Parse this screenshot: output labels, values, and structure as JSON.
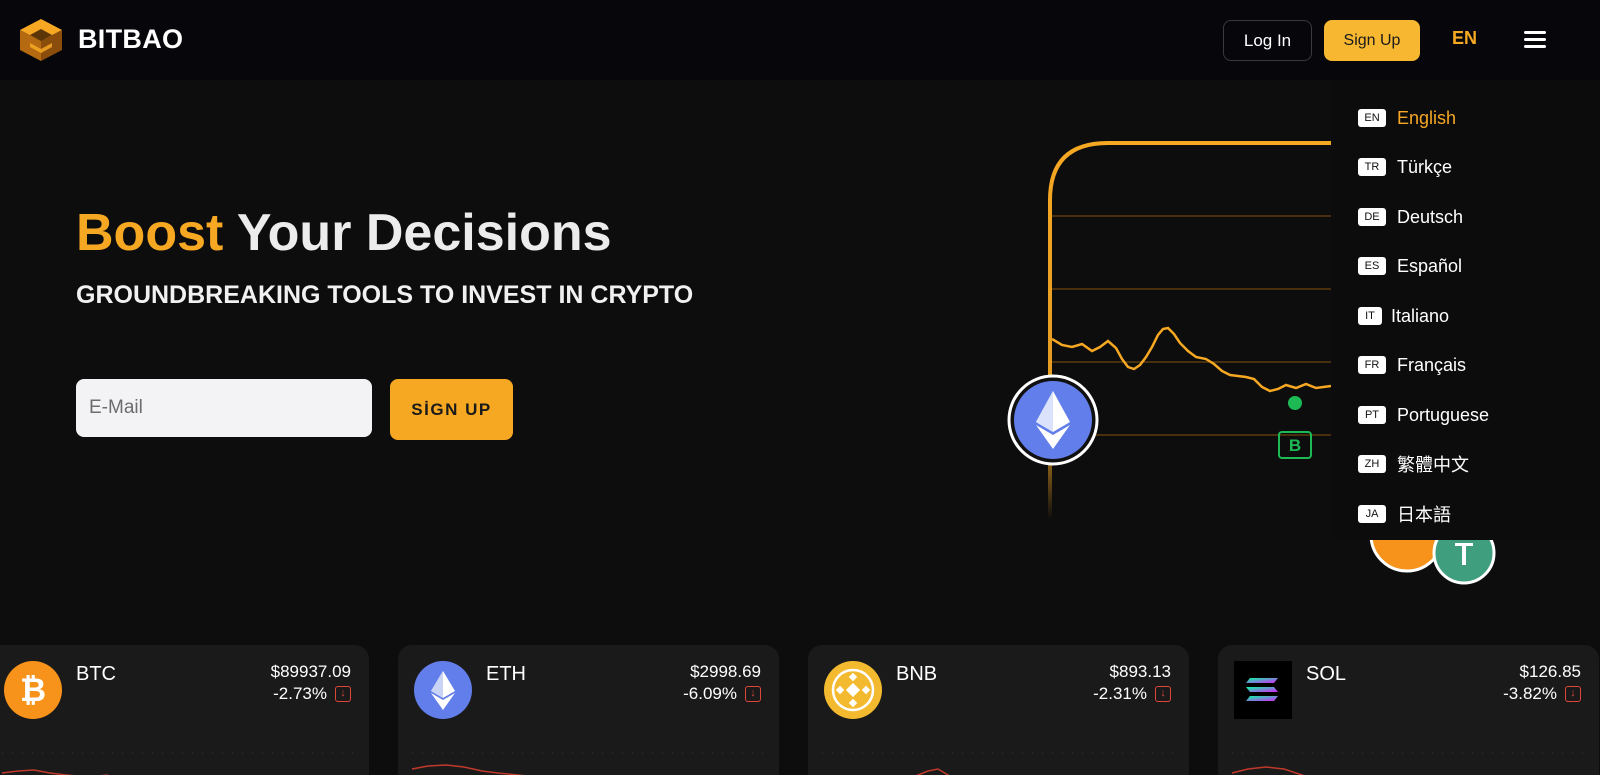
{
  "header": {
    "brand": "BITBAO",
    "login_label": "Log In",
    "signup_label": "Sign Up",
    "language": "EN"
  },
  "hero": {
    "title_accent": "Boost",
    "title_rest": " Your Decisions",
    "subtitle": "GROUNDBREAKING TOOLS TO INVEST IN CRYPTO",
    "email_placeholder": "E-Mail",
    "cta_label": "SİGN UP",
    "buy_marker": "B"
  },
  "language_menu": {
    "items": [
      {
        "code": "EN",
        "label": "English",
        "active": true
      },
      {
        "code": "TR",
        "label": "Türkçe"
      },
      {
        "code": "DE",
        "label": "Deutsch"
      },
      {
        "code": "ES",
        "label": "Español"
      },
      {
        "code": "IT",
        "label": "Italiano"
      },
      {
        "code": "FR",
        "label": "Français"
      },
      {
        "code": "PT",
        "label": "Portuguese"
      },
      {
        "code": "ZH",
        "label": "繁體中文"
      },
      {
        "code": "JA",
        "label": "日本語"
      }
    ]
  },
  "coins": [
    {
      "symbol": "BTC",
      "price": "$89937.09",
      "change": "-2.73%",
      "icon": "bitcoin-icon",
      "color": "#f7931a"
    },
    {
      "symbol": "ETH",
      "price": "$2998.69",
      "change": "-6.09%",
      "icon": "ethereum-icon",
      "color": "#627eea"
    },
    {
      "symbol": "BNB",
      "price": "$893.13",
      "change": "-2.31%",
      "icon": "bnb-icon",
      "color": "#f3ba2f"
    },
    {
      "symbol": "SOL",
      "price": "$126.85",
      "change": "-3.82%",
      "icon": "solana-icon",
      "color": "#000000"
    }
  ],
  "colors": {
    "accent": "#f7a823",
    "signup_button": "#f7b731",
    "negative": "#e0453a",
    "positive": "#1db954"
  }
}
